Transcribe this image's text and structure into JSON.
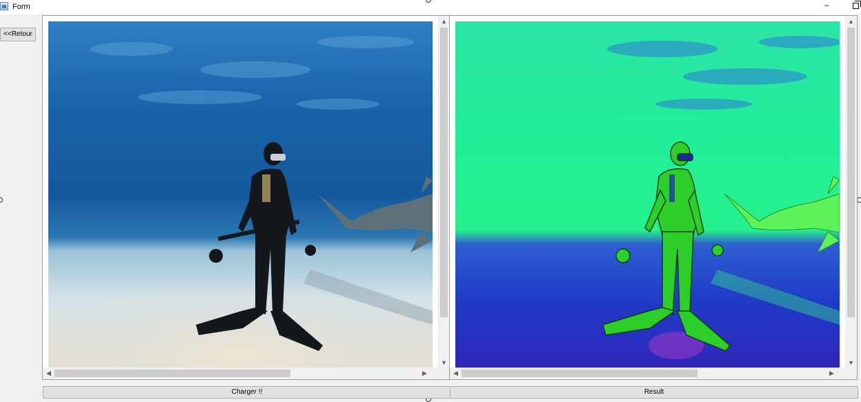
{
  "window": {
    "title": "Form"
  },
  "back_button": {
    "label": "<<Retour"
  },
  "panels": {
    "original": {
      "image": "underwater scuba diver standing on sand with tiger shark"
    },
    "result": {
      "image": "false-color version of the diver and shark image"
    }
  },
  "buttons": {
    "load_label": "Charger !!",
    "result_label": "Result"
  },
  "colors": {
    "window_bg": "#f0f0f0",
    "button_bg": "#e1e1e1",
    "scroll_thumb": "#cdcdcd"
  }
}
